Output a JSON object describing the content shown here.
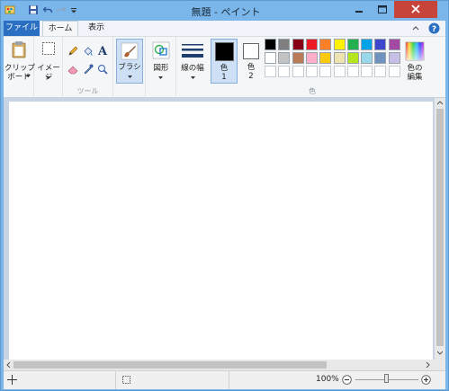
{
  "window": {
    "title": "無題 - ペイント"
  },
  "tabs": [
    {
      "label": "ファイル"
    },
    {
      "label": "ホーム"
    },
    {
      "label": "表示"
    }
  ],
  "ribbon": {
    "clipboard_label": "クリップ\nボード",
    "image_label": "イメージ",
    "tools_group_label": "ツール",
    "brush_label": "ブラシ",
    "shapes_label": "図形",
    "line_width_label": "線の幅",
    "color1_label": "色\n1",
    "color2_label": "色\n2",
    "colors_group_label": "色",
    "edit_colors_label": "色の\n編集"
  },
  "palette_row1": [
    "#000000",
    "#7f7f7f",
    "#880015",
    "#ed1c24",
    "#ff7f27",
    "#fff200",
    "#22b14c",
    "#00a2e8",
    "#3f48cc",
    "#a349a4"
  ],
  "palette_row2": [
    "#ffffff",
    "#c3c3c3",
    "#b97a57",
    "#ffaec9",
    "#ffc90e",
    "#efe4b0",
    "#b5e61d",
    "#99d9ea",
    "#7092be",
    "#c8bfe7"
  ],
  "status": {
    "zoom": "100%"
  }
}
